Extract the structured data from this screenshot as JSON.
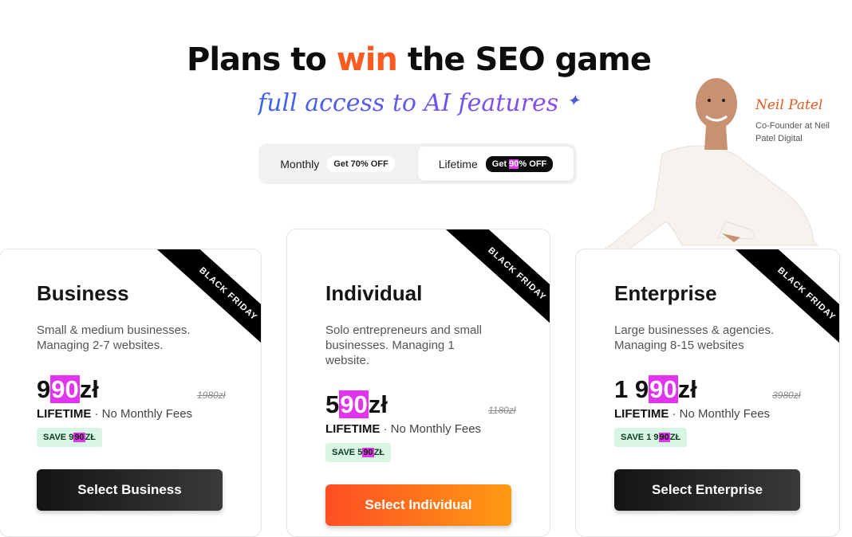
{
  "hero": {
    "title_before": "Plans to ",
    "title_accent": "win",
    "title_after": " the SEO game",
    "subtitle": "full access to AI features",
    "sparkle_icon": "sparkle-icon"
  },
  "billing_toggle": {
    "monthly_label": "Monthly",
    "monthly_badge": "Get 70% OFF",
    "lifetime_label": "Lifetime",
    "lifetime_badge_pre": "Get ",
    "lifetime_badge_hl": "90",
    "lifetime_badge_post": "% OFF",
    "selected": "Lifetime"
  },
  "presenter": {
    "name": "Neil Patel",
    "role": "Co-Founder at Neil Patel Digital"
  },
  "ribbon_text": "BLACK FRIDAY",
  "plans": [
    {
      "title": "Business",
      "desc": "Small & medium businesses. Managing 2-7 websites.",
      "price_pre": "9",
      "price_hl": "90",
      "price_post": "zł",
      "old_price": "1980zł",
      "lifetime": "LIFETIME",
      "lifetime_note": " · No Monthly Fees",
      "save_pre": "SAVE 9",
      "save_hl": "90",
      "save_post": "ZŁ",
      "button": "Select Business"
    },
    {
      "title": "Individual",
      "desc": "Solo entrepreneurs and small businesses. Managing 1 website.",
      "price_pre": "5",
      "price_hl": "90",
      "price_post": "zł",
      "old_price": "1180zł",
      "lifetime": "LIFETIME",
      "lifetime_note": " · No Monthly Fees",
      "save_pre": "SAVE 5",
      "save_hl": "90",
      "save_post": "ZŁ",
      "button": "Select Individual"
    },
    {
      "title": "Enterprise",
      "desc": "Large businesses & agencies. Managing 8-15 websites",
      "price_pre": "1 9",
      "price_hl": "90",
      "price_post": "zł",
      "old_price": "3980zł",
      "lifetime": "LIFETIME",
      "lifetime_note": " · No Monthly Fees",
      "save_pre": "SAVE 1 9",
      "save_hl": "90",
      "save_post": "ZŁ",
      "button": "Select Enterprise"
    }
  ],
  "colors": {
    "accent_orange": "#ff5a1f",
    "highlight_magenta": "#e134ee",
    "save_green_bg": "#d9f5e3",
    "button_dark": "#141414"
  }
}
